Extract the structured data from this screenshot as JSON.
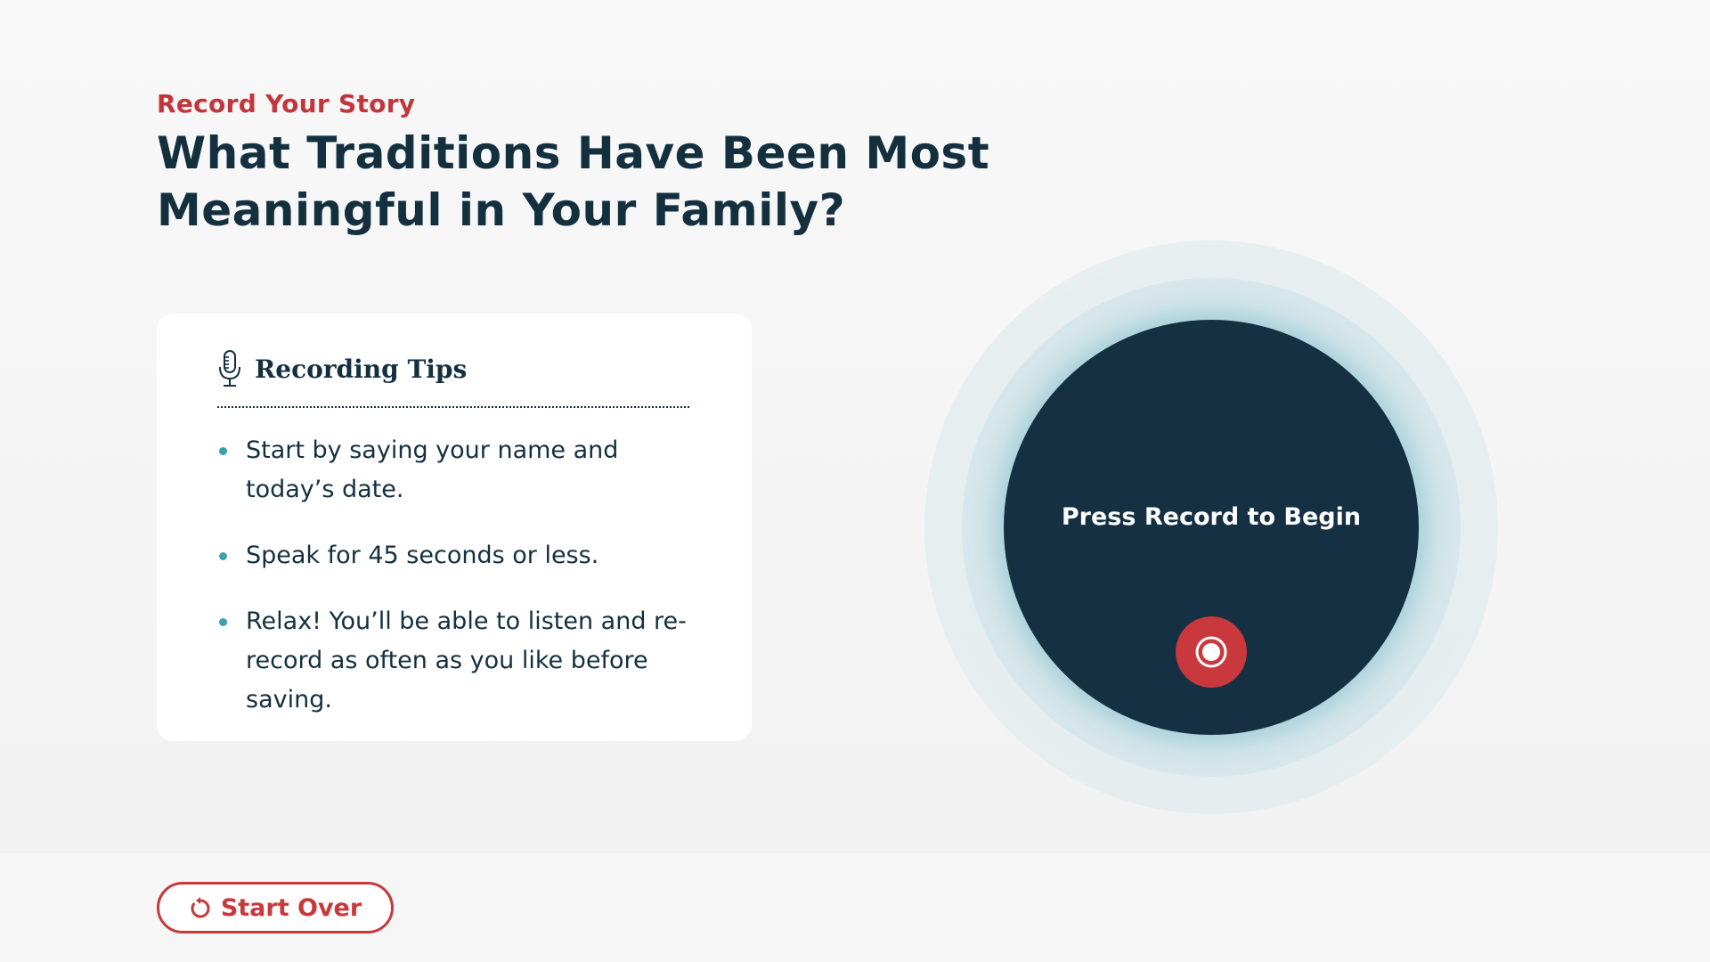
{
  "header": {
    "eyebrow": "Record Your Story",
    "question": "What Traditions Have Been Most Meaningful in Your Family?"
  },
  "tips": {
    "title": "Recording Tips",
    "icon": "microphone-icon",
    "items": [
      "Start by saying your name and today’s date.",
      "Speak for 45 seconds or less.",
      "Relax! You’ll be able to listen and re-record as often as you like before saving."
    ]
  },
  "recorder": {
    "prompt": "Press Record to Begin",
    "button_icon": "record-icon"
  },
  "footer": {
    "start_over_label": "Start Over",
    "start_over_icon": "restart-icon"
  },
  "colors": {
    "accent_red": "#c8383d",
    "navy": "#14303f",
    "bullet_teal": "#3aa1b3",
    "halo": "#d7e7eb"
  }
}
